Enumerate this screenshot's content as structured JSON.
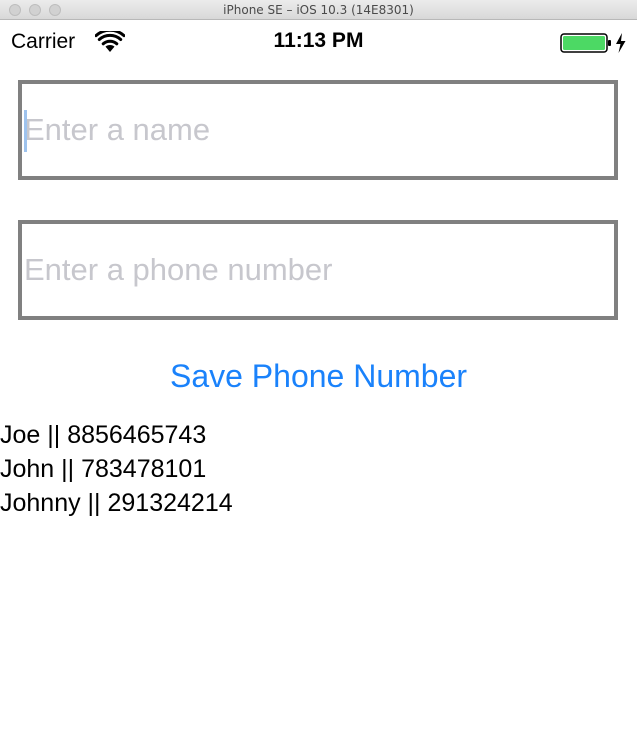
{
  "window": {
    "title": "iPhone SE – iOS 10.3 (14E8301)"
  },
  "status_bar": {
    "carrier": "Carrier",
    "time": "11:13 PM",
    "wifi_icon": "wifi-icon",
    "battery_icon": "battery-charging-icon",
    "battery_color": "#4cd964"
  },
  "form": {
    "name_placeholder": "Enter a name",
    "name_value": "",
    "phone_placeholder": "Enter a phone number",
    "phone_value": "",
    "save_label": "Save Phone Number",
    "accent_color": "#1a82fb"
  },
  "entries": [
    "Joe || 8856465743",
    "John || 783478101",
    "Johnny || 291324214"
  ]
}
